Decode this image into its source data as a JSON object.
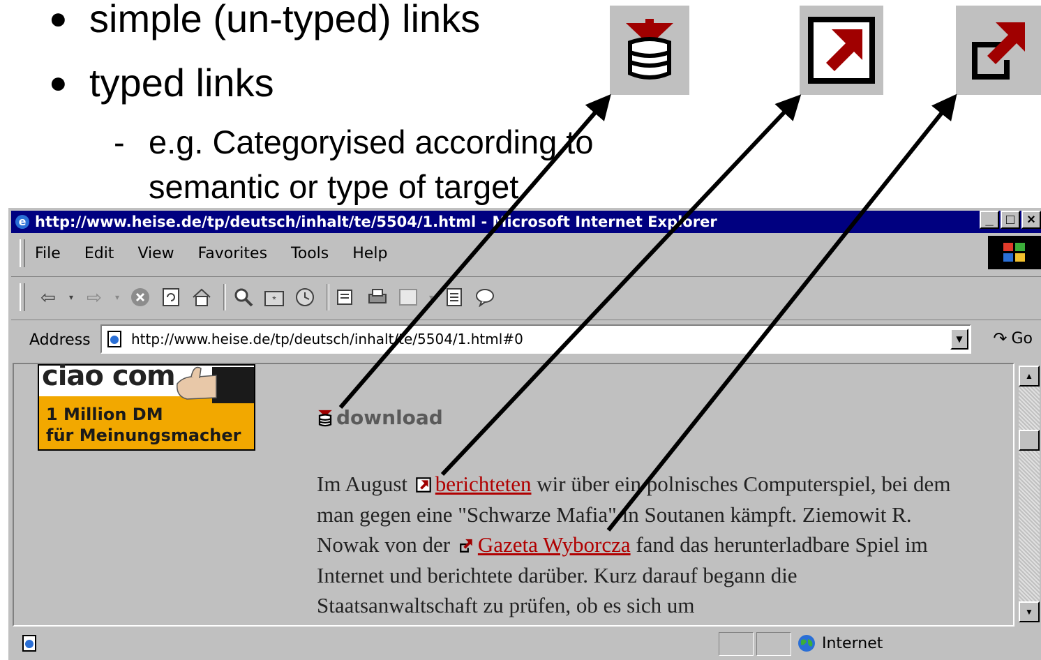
{
  "slide": {
    "bullets": [
      "simple (un-typed) links",
      "typed links"
    ],
    "sub_bullet": {
      "dash": "-",
      "line1": "e.g. Categoryised according to",
      "line2": "semantic or type of target"
    },
    "icons": [
      "download-icon",
      "external-link-boxed-icon",
      "external-link-open-icon"
    ]
  },
  "browser": {
    "title": "http://www.heise.de/tp/deutsch/inhalt/te/5504/1.html - Microsoft Internet Explorer",
    "window_buttons": [
      "_",
      "□",
      "×"
    ],
    "menu": [
      "File",
      "Edit",
      "View",
      "Favorites",
      "Tools",
      "Help"
    ],
    "address_label": "Address",
    "address_value": "http://www.heise.de/tp/deutsch/inhalt/te/5504/1.html#0",
    "go_label": "Go",
    "status_zone": "Internet"
  },
  "page": {
    "banner": {
      "brand": "ciao com",
      "line1": "1 Million DM",
      "line2": "für Meinungsmacher"
    },
    "download_label": "download",
    "article": {
      "t1": "Im August",
      "link1": "berichteten",
      "t2": " wir über ein polnisches Computerspiel, bei dem man gegen eine \"Schwarze Mafia\" in Soutanen kämpft. Ziemowit R. Nowak von der",
      "link2": "Gazeta Wyborcza",
      "t3": " fand das herunterladbare Spiel im Internet und berichtete darüber. Kurz darauf begann die Staatsanwaltschaft zu prüfen, ob es sich um"
    }
  },
  "colors": {
    "link_red": "#b00000",
    "title_bar": "#000080",
    "chrome_gray": "#c0c0c0",
    "banner_orange": "#f2a800"
  }
}
